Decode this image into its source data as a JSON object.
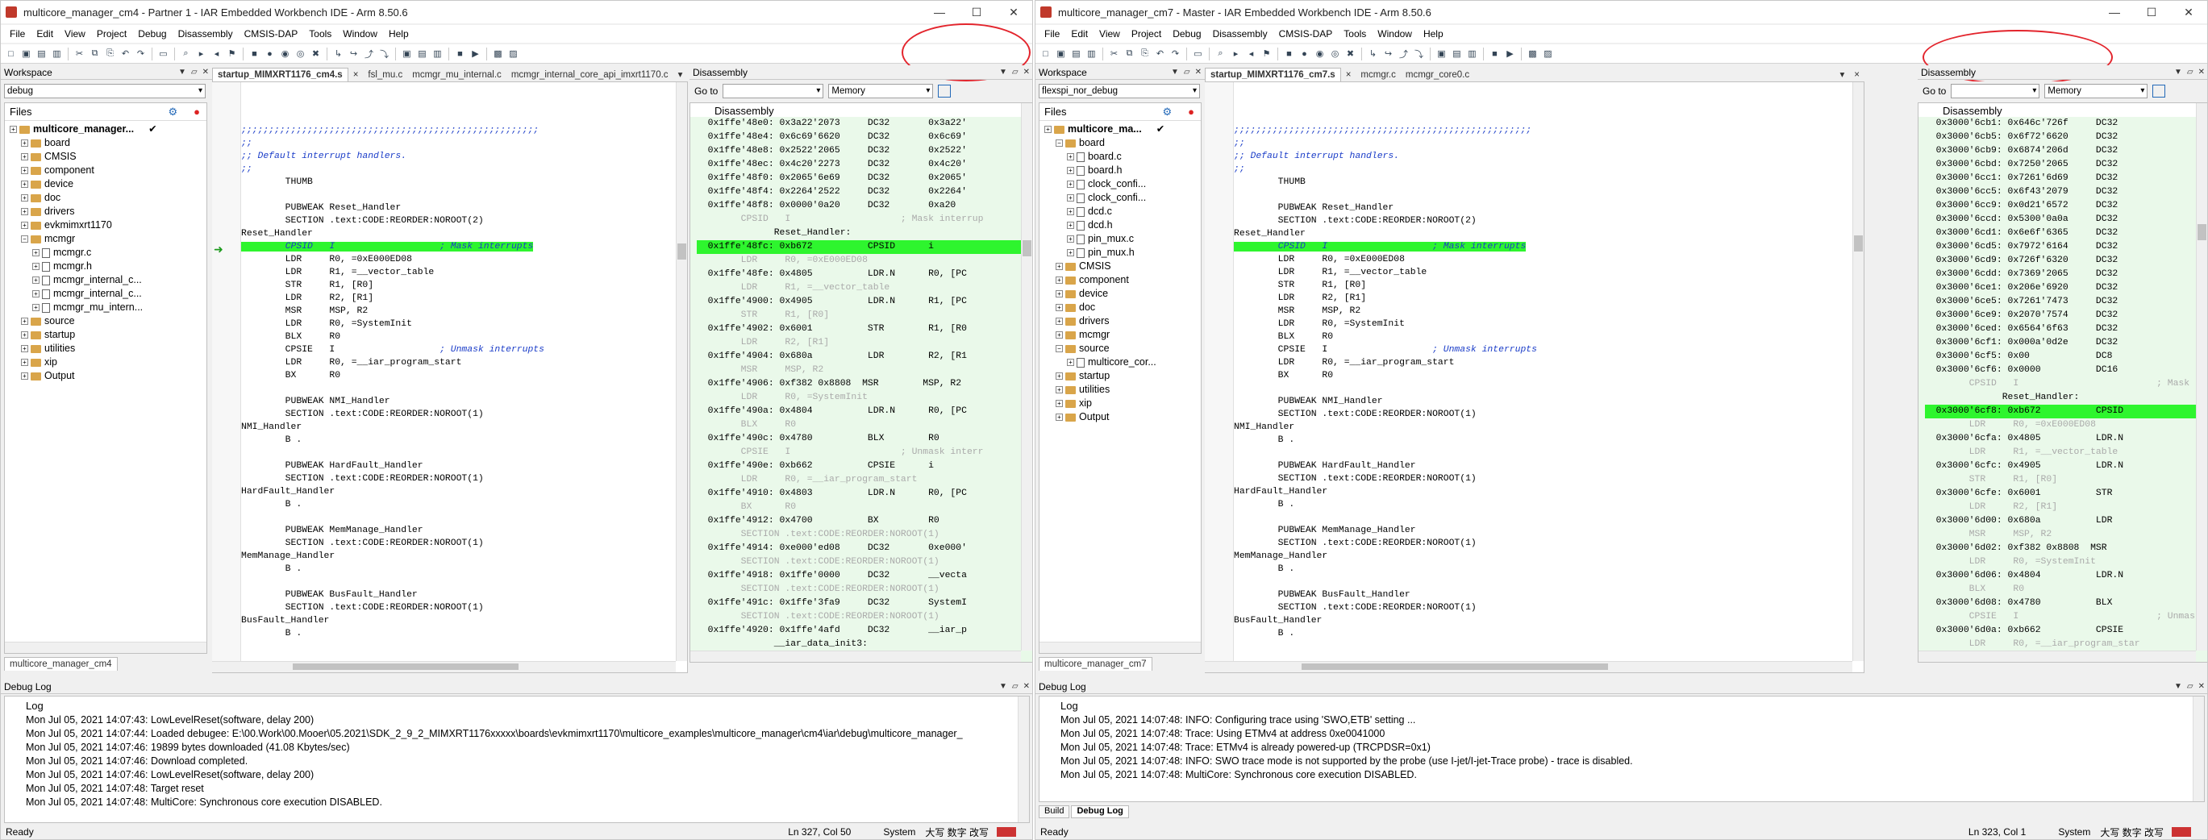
{
  "winA": {
    "title": "multicore_manager_cm4 - Partner 1 - IAR Embedded Workbench IDE - Arm 8.50.6",
    "menu": [
      "File",
      "Edit",
      "View",
      "Project",
      "Debug",
      "Disassembly",
      "CMSIS-DAP",
      "Tools",
      "Window",
      "Help"
    ],
    "workspace_label": "Workspace",
    "config": "debug",
    "files_label": "Files",
    "tree": [
      {
        "label": "multicore_manager...",
        "level": 0,
        "type": "project",
        "bold": true,
        "check": true
      },
      {
        "label": "board",
        "level": 1,
        "type": "folder"
      },
      {
        "label": "CMSIS",
        "level": 1,
        "type": "folder"
      },
      {
        "label": "component",
        "level": 1,
        "type": "folder"
      },
      {
        "label": "device",
        "level": 1,
        "type": "folder"
      },
      {
        "label": "doc",
        "level": 1,
        "type": "folder"
      },
      {
        "label": "drivers",
        "level": 1,
        "type": "folder"
      },
      {
        "label": "evkmimxrt1170",
        "level": 1,
        "type": "folder"
      },
      {
        "label": "mcmgr",
        "level": 1,
        "type": "folder",
        "open": true
      },
      {
        "label": "mcmgr.c",
        "level": 2,
        "type": "file"
      },
      {
        "label": "mcmgr.h",
        "level": 2,
        "type": "file"
      },
      {
        "label": "mcmgr_internal_c...",
        "level": 2,
        "type": "file"
      },
      {
        "label": "mcmgr_internal_c...",
        "level": 2,
        "type": "file"
      },
      {
        "label": "mcmgr_mu_intern...",
        "level": 2,
        "type": "file"
      },
      {
        "label": "source",
        "level": 1,
        "type": "folder"
      },
      {
        "label": "startup",
        "level": 1,
        "type": "folder"
      },
      {
        "label": "utilities",
        "level": 1,
        "type": "folder"
      },
      {
        "label": "xip",
        "level": 1,
        "type": "folder"
      },
      {
        "label": "Output",
        "level": 1,
        "type": "folder"
      }
    ],
    "workspace_tab": "multicore_manager_cm4",
    "editor_tabs": [
      "startup_MIMXRT1176_cm4.s",
      "fsl_mu.c",
      "mcmgr_mu_internal.c",
      "mcmgr_internal_core_api_imxrt1170.c"
    ],
    "code_lines": [
      {
        "t": ";;;;;;;;;;;;;;;;;;;;;;;;;;;;;;;;;;;;;;;;;;;;;;;;;;;;;;",
        "c": true
      },
      {
        "t": ";;",
        "c": true
      },
      {
        "t": ";; Default interrupt handlers.",
        "c": true
      },
      {
        "t": ";;",
        "c": true
      },
      {
        "t": "        THUMB"
      },
      {
        "t": ""
      },
      {
        "t": "        PUBWEAK Reset_Handler"
      },
      {
        "t": "        SECTION .text:CODE:REORDER:NOROOT(2)"
      },
      {
        "t": "Reset_Handler"
      },
      {
        "t": "        CPSID   I                   ; Mask interrupts",
        "hl": true
      },
      {
        "t": "        LDR     R0, =0xE000ED08"
      },
      {
        "t": "        LDR     R1, =__vector_table"
      },
      {
        "t": "        STR     R1, [R0]"
      },
      {
        "t": "        LDR     R2, [R1]"
      },
      {
        "t": "        MSR     MSP, R2"
      },
      {
        "t": "        LDR     R0, =SystemInit"
      },
      {
        "t": "        BLX     R0"
      },
      {
        "t": "        CPSIE   I                   ; Unmask interrupts"
      },
      {
        "t": "        LDR     R0, =__iar_program_start"
      },
      {
        "t": "        BX      R0"
      },
      {
        "t": ""
      },
      {
        "t": "        PUBWEAK NMI_Handler"
      },
      {
        "t": "        SECTION .text:CODE:REORDER:NOROOT(1)"
      },
      {
        "t": "NMI_Handler"
      },
      {
        "t": "        B ."
      },
      {
        "t": ""
      },
      {
        "t": "        PUBWEAK HardFault_Handler"
      },
      {
        "t": "        SECTION .text:CODE:REORDER:NOROOT(1)"
      },
      {
        "t": "HardFault_Handler"
      },
      {
        "t": "        B ."
      },
      {
        "t": ""
      },
      {
        "t": "        PUBWEAK MemManage_Handler"
      },
      {
        "t": "        SECTION .text:CODE:REORDER:NOROOT(1)"
      },
      {
        "t": "MemManage_Handler"
      },
      {
        "t": "        B ."
      },
      {
        "t": ""
      },
      {
        "t": "        PUBWEAK BusFault_Handler"
      },
      {
        "t": "        SECTION .text:CODE:REORDER:NOROOT(1)"
      },
      {
        "t": "BusFault_Handler"
      },
      {
        "t": "        B ."
      }
    ],
    "disasm_title": "Disassembly",
    "goto_label": "Go to",
    "memory_label": "Memory",
    "disasm_lines": [
      {
        "t": "  0x1ffe'48e0: 0x3a22'2073     DC32       0x3a22'"
      },
      {
        "t": "  0x1ffe'48e4: 0x6c69'6620     DC32       0x6c69'"
      },
      {
        "t": "  0x1ffe'48e8: 0x2522'2065     DC32       0x2522'"
      },
      {
        "t": "  0x1ffe'48ec: 0x4c20'2273     DC32       0x4c20'"
      },
      {
        "t": "  0x1ffe'48f0: 0x2065'6e69     DC32       0x2065'"
      },
      {
        "t": "  0x1ffe'48f4: 0x2264'2522     DC32       0x2264'"
      },
      {
        "t": "  0x1ffe'48f8: 0x0000'0a20     DC32       0xa20"
      },
      {
        "t": "        CPSID   I                    ; Mask interrup",
        "g": true
      },
      {
        "t": "              Reset_Handler:"
      },
      {
        "t": "  0x1ffe'48fc: 0xb672          CPSID      i",
        "hl": true
      },
      {
        "t": "        LDR     R0, =0xE000ED08",
        "g": true
      },
      {
        "t": "  0x1ffe'48fe: 0x4805          LDR.N      R0, [PC"
      },
      {
        "t": "        LDR     R1, =__vector_table",
        "g": true
      },
      {
        "t": "  0x1ffe'4900: 0x4905          LDR.N      R1, [PC"
      },
      {
        "t": "        STR     R1, [R0]",
        "g": true
      },
      {
        "t": "  0x1ffe'4902: 0x6001          STR        R1, [R0"
      },
      {
        "t": "        LDR     R2, [R1]",
        "g": true
      },
      {
        "t": "  0x1ffe'4904: 0x680a          LDR        R2, [R1"
      },
      {
        "t": "        MSR     MSP, R2",
        "g": true
      },
      {
        "t": "  0x1ffe'4906: 0xf382 0x8808  MSR        MSP, R2"
      },
      {
        "t": "        LDR     R0, =SystemInit",
        "g": true
      },
      {
        "t": "  0x1ffe'490a: 0x4804          LDR.N      R0, [PC"
      },
      {
        "t": "        BLX     R0",
        "g": true
      },
      {
        "t": "  0x1ffe'490c: 0x4780          BLX        R0"
      },
      {
        "t": "        CPSIE   I                    ; Unmask interr",
        "g": true
      },
      {
        "t": "  0x1ffe'490e: 0xb662          CPSIE      i"
      },
      {
        "t": "        LDR     R0, =__iar_program_start",
        "g": true
      },
      {
        "t": "  0x1ffe'4910: 0x4803          LDR.N      R0, [PC"
      },
      {
        "t": "        BX      R0",
        "g": true
      },
      {
        "t": "  0x1ffe'4912: 0x4700          BX         R0"
      },
      {
        "t": "        SECTION .text:CODE:REORDER:NOROOT(1)",
        "g": true
      },
      {
        "t": "  0x1ffe'4914: 0xe000'ed08     DC32       0xe000'"
      },
      {
        "t": "        SECTION .text:CODE:REORDER:NOROOT(1)",
        "g": true
      },
      {
        "t": "  0x1ffe'4918: 0x1ffe'0000     DC32       __vecta"
      },
      {
        "t": "        SECTION .text:CODE:REORDER:NOROOT(1)",
        "g": true
      },
      {
        "t": "  0x1ffe'491c: 0x1ffe'3fa9     DC32       SystemI"
      },
      {
        "t": "        SECTION .text:CODE:REORDER:NOROOT(1)",
        "g": true
      },
      {
        "t": "  0x1ffe'4920: 0x1ffe'4afd     DC32       __iar_p"
      },
      {
        "t": "              __iar_data_init3:"
      }
    ],
    "log_title": "Debug Log",
    "log_header": "Log",
    "log_lines": [
      "Mon Jul 05, 2021 14:07:43: LowLevelReset(software, delay 200)",
      "Mon Jul 05, 2021 14:07:44: Loaded debugee: E:\\00.Work\\00.Mooer\\05.2021\\SDK_2_9_2_MIMXRT1176xxxxx\\boards\\evkmimxrt1170\\multicore_examples\\multicore_manager\\cm4\\iar\\debug\\multicore_manager_",
      "Mon Jul 05, 2021 14:07:46: 19899 bytes downloaded (41.08 Kbytes/sec)",
      "Mon Jul 05, 2021 14:07:46: Download completed.",
      "Mon Jul 05, 2021 14:07:46: LowLevelReset(software, delay 200)",
      "Mon Jul 05, 2021 14:07:48: Target reset",
      "Mon Jul 05, 2021 14:07:48: MultiCore: Synchronous core execution DISABLED."
    ],
    "status_left": "Ready",
    "status_pos": "Ln 327, Col 50",
    "status_sys": "System",
    "status_ime": "大写  数字  改写"
  },
  "winB": {
    "title": "multicore_manager_cm7 - Master - IAR Embedded Workbench IDE - Arm 8.50.6",
    "menu": [
      "File",
      "Edit",
      "View",
      "Project",
      "Debug",
      "Disassembly",
      "CMSIS-DAP",
      "Tools",
      "Window",
      "Help"
    ],
    "workspace_label": "Workspace",
    "config": "flexspi_nor_debug",
    "files_label": "Files",
    "tree": [
      {
        "label": "multicore_ma...",
        "level": 0,
        "type": "project",
        "bold": true,
        "check": true
      },
      {
        "label": "board",
        "level": 1,
        "type": "folder",
        "open": true
      },
      {
        "label": "board.c",
        "level": 2,
        "type": "file"
      },
      {
        "label": "board.h",
        "level": 2,
        "type": "file"
      },
      {
        "label": "clock_confi...",
        "level": 2,
        "type": "file"
      },
      {
        "label": "clock_confi...",
        "level": 2,
        "type": "file"
      },
      {
        "label": "dcd.c",
        "level": 2,
        "type": "file"
      },
      {
        "label": "dcd.h",
        "level": 2,
        "type": "file"
      },
      {
        "label": "pin_mux.c",
        "level": 2,
        "type": "file"
      },
      {
        "label": "pin_mux.h",
        "level": 2,
        "type": "file"
      },
      {
        "label": "CMSIS",
        "level": 1,
        "type": "folder"
      },
      {
        "label": "component",
        "level": 1,
        "type": "folder"
      },
      {
        "label": "device",
        "level": 1,
        "type": "folder"
      },
      {
        "label": "doc",
        "level": 1,
        "type": "folder"
      },
      {
        "label": "drivers",
        "level": 1,
        "type": "folder"
      },
      {
        "label": "mcmgr",
        "level": 1,
        "type": "folder"
      },
      {
        "label": "source",
        "level": 1,
        "type": "folder",
        "open": true
      },
      {
        "label": "multicore_cor...",
        "level": 2,
        "type": "file"
      },
      {
        "label": "startup",
        "level": 1,
        "type": "folder"
      },
      {
        "label": "utilities",
        "level": 1,
        "type": "folder"
      },
      {
        "label": "xip",
        "level": 1,
        "type": "folder"
      },
      {
        "label": "Output",
        "level": 1,
        "type": "folder"
      }
    ],
    "workspace_tab": "multicore_manager_cm7",
    "editor_tabs": [
      "startup_MIMXRT1176_cm7.s",
      "mcmgr.c",
      "mcmgr_core0.c"
    ],
    "code_lines": [
      {
        "t": ";;;;;;;;;;;;;;;;;;;;;;;;;;;;;;;;;;;;;;;;;;;;;;;;;;;;;;",
        "c": true
      },
      {
        "t": ";;",
        "c": true
      },
      {
        "t": ";; Default interrupt handlers.",
        "c": true
      },
      {
        "t": ";;",
        "c": true
      },
      {
        "t": "        THUMB"
      },
      {
        "t": ""
      },
      {
        "t": "        PUBWEAK Reset_Handler"
      },
      {
        "t": "        SECTION .text:CODE:REORDER:NOROOT(2)"
      },
      {
        "t": "Reset_Handler"
      },
      {
        "t": "        CPSID   I                   ; Mask interrupts",
        "hl": true
      },
      {
        "t": "        LDR     R0, =0xE000ED08"
      },
      {
        "t": "        LDR     R1, =__vector_table"
      },
      {
        "t": "        STR     R1, [R0]"
      },
      {
        "t": "        LDR     R2, [R1]"
      },
      {
        "t": "        MSR     MSP, R2"
      },
      {
        "t": "        LDR     R0, =SystemInit"
      },
      {
        "t": "        BLX     R0"
      },
      {
        "t": "        CPSIE   I                   ; Unmask interrupts"
      },
      {
        "t": "        LDR     R0, =__iar_program_start"
      },
      {
        "t": "        BX      R0"
      },
      {
        "t": ""
      },
      {
        "t": "        PUBWEAK NMI_Handler"
      },
      {
        "t": "        SECTION .text:CODE:REORDER:NOROOT(1)"
      },
      {
        "t": "NMI_Handler"
      },
      {
        "t": "        B ."
      },
      {
        "t": ""
      },
      {
        "t": "        PUBWEAK HardFault_Handler"
      },
      {
        "t": "        SECTION .text:CODE:REORDER:NOROOT(1)"
      },
      {
        "t": "HardFault_Handler"
      },
      {
        "t": "        B ."
      },
      {
        "t": ""
      },
      {
        "t": "        PUBWEAK MemManage_Handler"
      },
      {
        "t": "        SECTION .text:CODE:REORDER:NOROOT(1)"
      },
      {
        "t": "MemManage_Handler"
      },
      {
        "t": "        B ."
      },
      {
        "t": ""
      },
      {
        "t": "        PUBWEAK BusFault_Handler"
      },
      {
        "t": "        SECTION .text:CODE:REORDER:NOROOT(1)"
      },
      {
        "t": "BusFault_Handler"
      },
      {
        "t": "        B ."
      }
    ],
    "disasm_title": "Disassembly",
    "goto_label": "Go to",
    "memory_label": "Memory",
    "disasm_lines": [
      {
        "t": "  0x3000'6cb1: 0x646c'726f     DC32"
      },
      {
        "t": "  0x3000'6cb5: 0x6f72'6620     DC32"
      },
      {
        "t": "  0x3000'6cb9: 0x6874'206d     DC32"
      },
      {
        "t": "  0x3000'6cbd: 0x7250'2065     DC32"
      },
      {
        "t": "  0x3000'6cc1: 0x7261'6d69     DC32"
      },
      {
        "t": "  0x3000'6cc5: 0x6f43'2079     DC32"
      },
      {
        "t": "  0x3000'6cc9: 0x0d21'6572     DC32"
      },
      {
        "t": "  0x3000'6ccd: 0x5300'0a0a     DC32"
      },
      {
        "t": "  0x3000'6cd1: 0x6e6f'6365     DC32"
      },
      {
        "t": "  0x3000'6cd5: 0x7972'6164     DC32"
      },
      {
        "t": "  0x3000'6cd9: 0x726f'6320     DC32"
      },
      {
        "t": "  0x3000'6cdd: 0x7369'2065     DC32"
      },
      {
        "t": "  0x3000'6ce1: 0x206e'6920     DC32"
      },
      {
        "t": "  0x3000'6ce5: 0x7261'7473     DC32"
      },
      {
        "t": "  0x3000'6ce9: 0x2070'7574     DC32"
      },
      {
        "t": "  0x3000'6ced: 0x6564'6f63     DC32"
      },
      {
        "t": "  0x3000'6cf1: 0x000a'0d2e     DC32"
      },
      {
        "t": "  0x3000'6cf5: 0x00            DC8"
      },
      {
        "t": "  0x3000'6cf6: 0x0000          DC16"
      },
      {
        "t": "        CPSID   I                         ; Mask",
        "g": true
      },
      {
        "t": "              Reset_Handler:"
      },
      {
        "t": "  0x3000'6cf8: 0xb672          CPSID",
        "hl": true
      },
      {
        "t": "        LDR     R0, =0xE000ED08",
        "g": true
      },
      {
        "t": "  0x3000'6cfa: 0x4805          LDR.N"
      },
      {
        "t": "        LDR     R1, =__vector_table",
        "g": true
      },
      {
        "t": "  0x3000'6cfc: 0x4905          LDR.N"
      },
      {
        "t": "        STR     R1, [R0]",
        "g": true
      },
      {
        "t": "  0x3000'6cfe: 0x6001          STR"
      },
      {
        "t": "        LDR     R2, [R1]",
        "g": true
      },
      {
        "t": "  0x3000'6d00: 0x680a          LDR"
      },
      {
        "t": "        MSR     MSP, R2",
        "g": true
      },
      {
        "t": "  0x3000'6d02: 0xf382 0x8808  MSR"
      },
      {
        "t": "        LDR     R0, =SystemInit",
        "g": true
      },
      {
        "t": "  0x3000'6d06: 0x4804          LDR.N"
      },
      {
        "t": "        BLX     R0",
        "g": true
      },
      {
        "t": "  0x3000'6d08: 0x4780          BLX"
      },
      {
        "t": "        CPSIE   I                         ; Unmas",
        "g": true
      },
      {
        "t": "  0x3000'6d0a: 0xb662          CPSIE"
      },
      {
        "t": "        LDR     R0, =__iar_program_star",
        "g": true
      }
    ],
    "log_title": "Debug Log",
    "log_header": "Log",
    "log_lines": [
      "Mon Jul 05, 2021 14:07:48: INFO: Configuring trace using 'SWO,ETB' setting ...",
      "Mon Jul 05, 2021 14:07:48: Trace: Using ETMv4 at address 0xe0041000",
      "Mon Jul 05, 2021 14:07:48: Trace: ETMv4 is already powered-up (TRCPDSR=0x1)",
      "Mon Jul 05, 2021 14:07:48: INFO: SWO trace mode is not supported by the probe (use I-jet/I-jet-Trace probe) - trace is disabled.",
      "Mon Jul 05, 2021 14:07:48: MultiCore: Synchronous core execution DISABLED."
    ],
    "log_tabs": [
      "Build",
      "Debug Log"
    ],
    "status_left": "Ready",
    "status_pos": "Ln 323, Col 1",
    "status_sys": "System",
    "status_ime": "大写  数字  改写"
  },
  "colors": {
    "highlight": "#2ef52e",
    "comment": "#1a3cc8",
    "annotation_ring": "#e3252d"
  }
}
